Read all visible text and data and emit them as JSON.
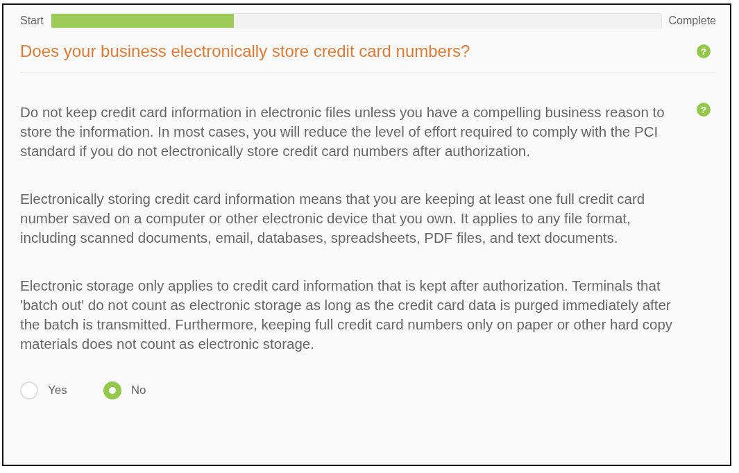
{
  "progress": {
    "start_label": "Start",
    "end_label": "Complete",
    "level": 0.3
  },
  "question": {
    "title": "Does your business electronically store credit card numbers?",
    "help": "?"
  },
  "explanation": {
    "help": "?",
    "paragraphs": [
      "Do not keep credit card information in electronic files unless you have a compelling business reason to store the information. In most cases, you will reduce the level of effort required to comply with the PCI standard if you do not electronically store credit card numbers after authorization.",
      "Electronically storing credit card information means that you are keeping at least one full credit card number saved on a computer or other electronic device that you own. It applies to any file format, including scanned documents, email, databases, spreadsheets, PDF files, and text documents.",
      "Electronic storage only applies to credit card information that is kept after authorization. Terminals that 'batch out' do not count as electronic storage as long as the credit card data is purged immediately after the batch is transmitted. Furthermore, keeping full credit card numbers only on paper or other hard copy materials does not count as electronic storage."
    ]
  },
  "options": [
    {
      "label": "Yes",
      "selected": false
    },
    {
      "label": "No",
      "selected": true
    }
  ]
}
